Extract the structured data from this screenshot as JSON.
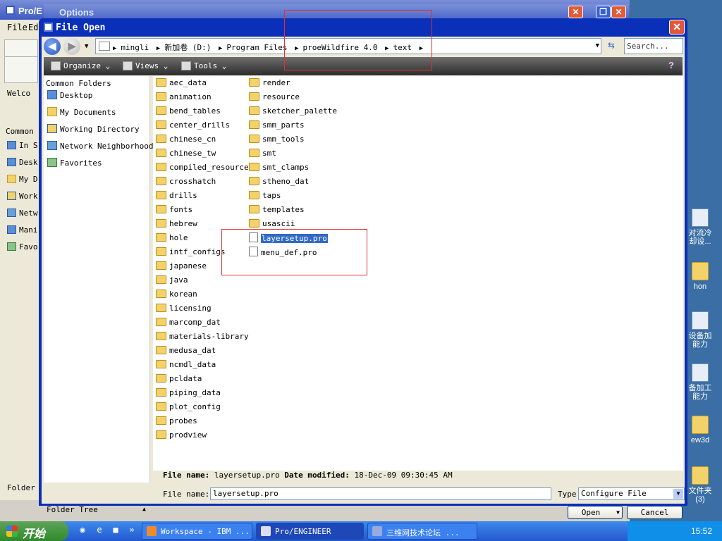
{
  "background": {
    "proe_title": "Pro/E",
    "options_title": "Options",
    "menu": [
      "File",
      "Ed"
    ],
    "left_panel": {
      "welcome": "Welco",
      "common": "Common",
      "items": [
        "In S",
        "Desk",
        "My D",
        "Work",
        "Netw",
        "Mani",
        "Favo"
      ],
      "folder_tree": "Folder T"
    },
    "desktop_icons": [
      "对流冷却设...",
      "hon",
      "设备加能力",
      "备加工能力",
      "ew3d",
      "文件夹(3)"
    ]
  },
  "dialog": {
    "title": "File Open",
    "close": "✕",
    "address": {
      "crumbs": [
        "mingli",
        "新加卷 (D:)",
        "Program Files",
        "proeWildfire 4.0",
        "text"
      ],
      "search_placeholder": "Search..."
    },
    "toolbar": {
      "organize": "Organize",
      "views": "Views",
      "tools": "Tools"
    },
    "common_folders": {
      "header": "Common Folders",
      "items": [
        "Desktop",
        "My Documents",
        "Working Directory",
        "Network Neighborhood",
        "Favorites"
      ]
    },
    "files": {
      "column1": [
        "aec_data",
        "animation",
        "bend_tables",
        "center_drills",
        "chinese_cn",
        "chinese_tw",
        "compiled_resource",
        "crosshatch",
        "drills",
        "fonts",
        "hebrew",
        "hole",
        "intf_configs",
        "japanese",
        "java",
        "korean",
        "licensing",
        "marcomp_dat",
        "materials-library",
        "medusa_dat",
        "ncmdl_data",
        "pcldata",
        "piping_data",
        "plot_config",
        "probes",
        "prodview"
      ],
      "column2_folders": [
        "render",
        "resource",
        "sketcher_palette",
        "smm_parts",
        "smm_tools",
        "smt",
        "smt_clamps",
        "stheno_dat",
        "taps",
        "templates",
        "usascii"
      ],
      "column2_files": [
        "layersetup.pro",
        "menu_def.pro"
      ],
      "selected": "layersetup.pro"
    },
    "info": {
      "name_label": "File name:",
      "name_value": "layersetup.pro",
      "date_label": "Date modified:",
      "date_value": "18-Dec-09 09:30:45 AM"
    },
    "filename_label": "File name:",
    "filename_value": "layersetup.pro",
    "type_label": "Type",
    "type_value": "Configure File",
    "folder_tree": "Folder Tree",
    "open": "Open",
    "cancel": "Cancel"
  },
  "taskbar": {
    "start": "开始",
    "tasks": [
      "Workspace - IBM ...",
      "Pro/ENGINEER",
      "三维网技术论坛 ..."
    ],
    "clock": "15:52"
  }
}
